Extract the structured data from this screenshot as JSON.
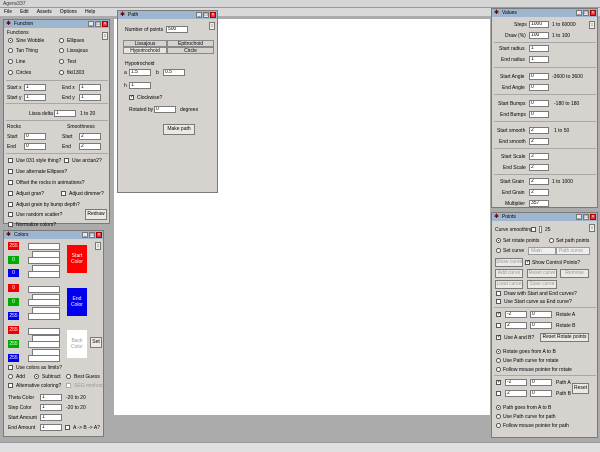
{
  "app": {
    "title": "Agens337",
    "menu": [
      "File",
      "Edit",
      "Assets",
      "Options",
      "Help"
    ]
  },
  "function_panel": {
    "title": "Function",
    "group": "Functions",
    "options": [
      "Sine Wobble",
      "Ellipses",
      "Tan Thing",
      "Lissajous",
      "Line",
      "Test",
      "Circles",
      "fiki1303"
    ],
    "start_x_label": "Start x",
    "start_x": "1",
    "end_x_label": "End x",
    "end_x": "1",
    "start_y_label": "Start y",
    "start_y": "1",
    "end_y_label": "End y",
    "end_y": "1",
    "lissa_label": "Lissa delta",
    "lissa": "1",
    "lissa_range": "1 to 20",
    "rocks_label": "Rocks",
    "rocks_start_label": "Start",
    "rocks_start": "0",
    "rocks_end_label": "End",
    "rocks_end": "0",
    "smooth_label": "Smoothness",
    "smooth_start_label": "Start",
    "smooth_start": "2",
    "smooth_end_label": "End",
    "smooth_end": "2",
    "checks": [
      "Use 031 style thing?",
      "Use arctan2?",
      "Use alternate Ellipses?",
      "Offset the rocks in animations?",
      "Adjust gran?",
      "Adjust dimmer?",
      "Adjust grain by bump depth?",
      "Use random scatter?",
      "Normalize colors?"
    ],
    "redraw": "Redraw"
  },
  "colors_panel": {
    "title": "Colors",
    "start_vals": [
      "255",
      "0",
      "0"
    ],
    "start_label": "Start Color",
    "end_vals": [
      "0",
      "0",
      "255"
    ],
    "end_label": "End Color",
    "back_vals": [
      "255",
      "255",
      "255"
    ],
    "back_label": "Back Color",
    "set": "Set",
    "use_limits": "Use colors as limits?",
    "add": "Add",
    "subtract": "Subtract",
    "best": "Best Guess",
    "alt_color": "Alternative coloring?",
    "seg": "SEG method?",
    "theta_label": "Theta Color",
    "theta": "1",
    "theta_range": "-20 to 20",
    "step_label": "Step Color",
    "step": "1",
    "step_range": "-20 to 20",
    "start_amt_label": "Start Amount",
    "start_amt": "1",
    "end_amt_label": "End Amount",
    "end_amt": "1",
    "abba": "A -> B -> A?"
  },
  "path_panel": {
    "title": "Path",
    "points_label": "Number of points",
    "points": "500",
    "tabs_row1": [
      "Lissajous",
      "Epitrochoid"
    ],
    "tabs_row2": [
      "Hypotrochoid",
      "Circle"
    ],
    "section": "Hypotrochoid",
    "a_label": "a",
    "a": "1.5",
    "b_label": "b",
    "b": "0.5",
    "h_label": "h",
    "h": "1",
    "clockwise": "Clockwise?",
    "rotated_label": "Rotated by",
    "rotated": "0",
    "degrees": "degrees",
    "make": "Make path"
  },
  "values_panel": {
    "title": "Values",
    "steps_label": "Steps",
    "steps": "1000",
    "steps_range": "1 to 60000",
    "draw_label": "Draw (%)",
    "draw": "100",
    "draw_range": "1 to 100",
    "start_radius_label": "Start radius",
    "start_radius": "1",
    "end_radius_label": "End radius",
    "end_radius": "1",
    "start_angle_label": "Start Angle",
    "start_angle": "0",
    "angle_range": "-3600 to 3600",
    "end_angle_label": "End Angle",
    "end_angle": "0",
    "start_bumps_label": "Start Bumps",
    "start_bumps": "0",
    "bumps_range": "-180 to 180",
    "end_bumps_label": "End Bumps",
    "end_bumps": "0",
    "start_smooth_label": "Start smooth",
    "start_smooth": "2",
    "smooth_range": "1 to 50",
    "end_smooth_label": "End smooth",
    "end_smooth": "2",
    "start_scale_label": "Start Scale",
    "start_scale": "2",
    "end_scale_label": "End Scale",
    "end_scale": "2",
    "start_grain_label": "Start Grain",
    "start_grain": "2",
    "grain_range": "1 to 1000",
    "end_grain_label": "End Grain",
    "end_grain": "2",
    "mult_label": "Multiplier",
    "mult": "357"
  },
  "points_panel": {
    "title": "Points",
    "curve_smooth_label": "Curve smoothing",
    "curve_smooth": "25",
    "set_rotate": "Set rotate points",
    "set_path": "Set path points",
    "set_curve": "Set curve",
    "curve_sel1": "Main",
    "curve_sel2": "Path curve",
    "show_curve": "Show curve",
    "show_ctrl": "Show Control Points?",
    "add_curve": "Add curve",
    "reset_curve": "Reset curve",
    "remove": "Remove",
    "load_curve": "Load curve",
    "save_curve": "Save curve",
    "draw_se": "Draw with Start and End curves?",
    "use_start_end": "Use Start curve as End curve?",
    "rot_a_x": "-2",
    "rot_a_y": "0",
    "rot_a_label": "Rotate A",
    "rot_b_x": "2",
    "rot_b_y": "0",
    "rot_b_label": "Rotate B",
    "use_ab": "Use A and B?",
    "reset_rot": "Reset Rotate points",
    "rot_goes": "Rotate goes from A to B",
    "use_path_rot": "Use Path curve for rotate",
    "follow_rot": "Follow mouse pointer for rotate",
    "path_a_x": "-2",
    "path_a_y": "0",
    "path_a_label": "Path A",
    "path_b_x": "2",
    "path_b_y": "0",
    "path_b_label": "Path B",
    "reset": "Reset",
    "path_goes": "Path goes from A to B",
    "use_path_path": "Use Path curve for path",
    "follow_path": "Follow mouse pointer for path"
  }
}
